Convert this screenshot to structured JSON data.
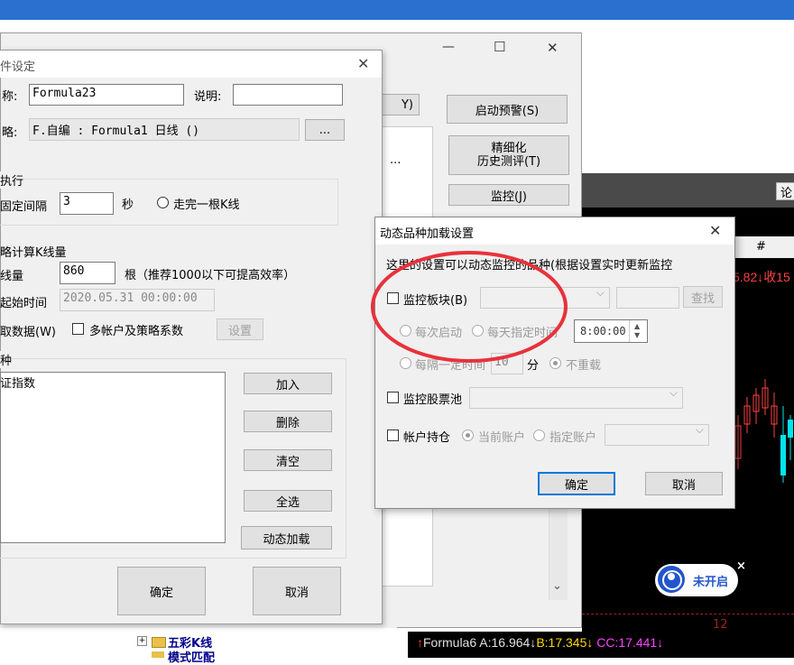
{
  "bg_window": {
    "min_glyph": "—",
    "max_glyph": "☐",
    "close_glyph": "✕",
    "buttons": [
      "启动预警(S)",
      "精细化\n历史测评(T)",
      "监控(J)"
    ],
    "partial_button": "Y)",
    "ellipsis": "...",
    "arrow_button": ">>",
    "scroll_down": "⌄"
  },
  "chart_window": {
    "partial_label": "论",
    "toolbar_grid": "#",
    "price_text": "5.82↓收15",
    "x_tick": "12",
    "formula_line": {
      "name": "Formula6",
      "a": "A:16.964↓",
      "b": "B:17.345↓",
      "c": "CC:17.441↓"
    },
    "badge": {
      "label": "未开启",
      "close": "×"
    }
  },
  "tree": {
    "items": [
      "五彩K线",
      "模式匹配"
    ]
  },
  "cond_dialog": {
    "title": "件设定",
    "close": "✕",
    "name_label": "称:",
    "name_value": "Formula23",
    "desc_label": "说明:",
    "desc_value": "",
    "strategy_label": "略:",
    "strategy_value": "F.自编 : Formula1 日线 ()",
    "strategy_btn": "...",
    "exec_section": "执行",
    "interval_label": "固定间隔",
    "interval_value": "3",
    "seconds_unit": "秒",
    "kline_radio": "走完一根K线",
    "calc_section": "略计算K线量",
    "kcount_label": "线量",
    "kcount_value": "860",
    "kcount_hint": "根（推荐1000以下可提高效率）",
    "start_label": "起始时间",
    "start_value": "2020.05.31 00:00:00",
    "data_label": "取数据(W)",
    "multi_account": "多帐户及策略系数",
    "settings_btn": "设置",
    "variety_section": "种",
    "list_items": [
      "证指数"
    ],
    "side_buttons": [
      "加入",
      "删除",
      "清空",
      "全选",
      "动态加载"
    ],
    "ok": "确定",
    "cancel": "取消"
  },
  "dyn_dialog": {
    "title": "动态品种加载设置",
    "close": "✕",
    "description": "这里的设置可以动态监控的品种(根据设置实时更新监控",
    "monitor_block": "监控板块(B)",
    "search_btn": "查找",
    "each_start": "每次启动",
    "each_day": "每天指定时间",
    "time_value": "8:00:00",
    "every_interval": "每隔一定时间",
    "interval_value": "10",
    "minute_unit": "分",
    "no_reload": "不重载",
    "monitor_pool": "监控股票池",
    "account_hold": "帐户持仓",
    "current_account": "当前账户",
    "specified_account": "指定账户",
    "ok": "确定",
    "cancel": "取消"
  },
  "colors": {
    "title_blue": "#2b6fcf",
    "highlight_red": "#e8323a",
    "chart_bg": "#000000",
    "candle_red": "#ff4040",
    "candle_cyan": "#00e5ee"
  }
}
